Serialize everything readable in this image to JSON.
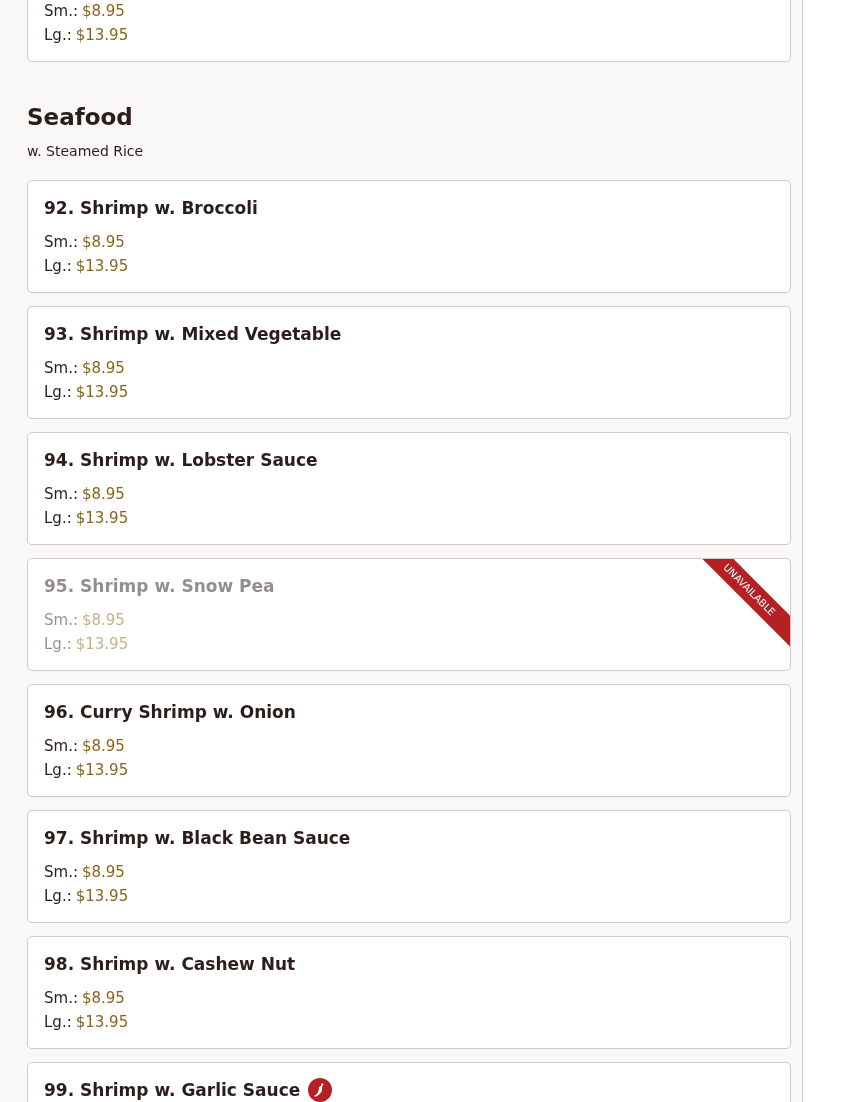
{
  "previous_item": {
    "prices": [
      {
        "label": "Sm.:",
        "price": "$8.95"
      },
      {
        "label": "Lg.:",
        "price": "$13.95"
      }
    ]
  },
  "section": {
    "title": "Seafood",
    "subtitle": "w. Steamed Rice"
  },
  "unavailable_label": "UNAVAILABLE",
  "items": [
    {
      "name": "92. Shrimp w. Broccoli",
      "available": true,
      "spicy": false,
      "prices": [
        {
          "label": "Sm.:",
          "price": "$8.95"
        },
        {
          "label": "Lg.:",
          "price": "$13.95"
        }
      ]
    },
    {
      "name": "93. Shrimp w. Mixed Vegetable",
      "available": true,
      "spicy": false,
      "prices": [
        {
          "label": "Sm.:",
          "price": "$8.95"
        },
        {
          "label": "Lg.:",
          "price": "$13.95"
        }
      ]
    },
    {
      "name": "94. Shrimp w. Lobster Sauce",
      "available": true,
      "spicy": false,
      "prices": [
        {
          "label": "Sm.:",
          "price": "$8.95"
        },
        {
          "label": "Lg.:",
          "price": "$13.95"
        }
      ]
    },
    {
      "name": "95. Shrimp w. Snow Pea",
      "available": false,
      "spicy": false,
      "prices": [
        {
          "label": "Sm.:",
          "price": "$8.95"
        },
        {
          "label": "Lg.:",
          "price": "$13.95"
        }
      ]
    },
    {
      "name": "96. Curry Shrimp w. Onion",
      "available": true,
      "spicy": false,
      "prices": [
        {
          "label": "Sm.:",
          "price": "$8.95"
        },
        {
          "label": "Lg.:",
          "price": "$13.95"
        }
      ]
    },
    {
      "name": "97. Shrimp w. Black Bean Sauce",
      "available": true,
      "spicy": false,
      "prices": [
        {
          "label": "Sm.:",
          "price": "$8.95"
        },
        {
          "label": "Lg.:",
          "price": "$13.95"
        }
      ]
    },
    {
      "name": "98. Shrimp w. Cashew Nut",
      "available": true,
      "spicy": false,
      "prices": [
        {
          "label": "Sm.:",
          "price": "$8.95"
        },
        {
          "label": "Lg.:",
          "price": "$13.95"
        }
      ]
    },
    {
      "name": "99. Shrimp w. Garlic Sauce",
      "available": true,
      "spicy": true
    }
  ]
}
